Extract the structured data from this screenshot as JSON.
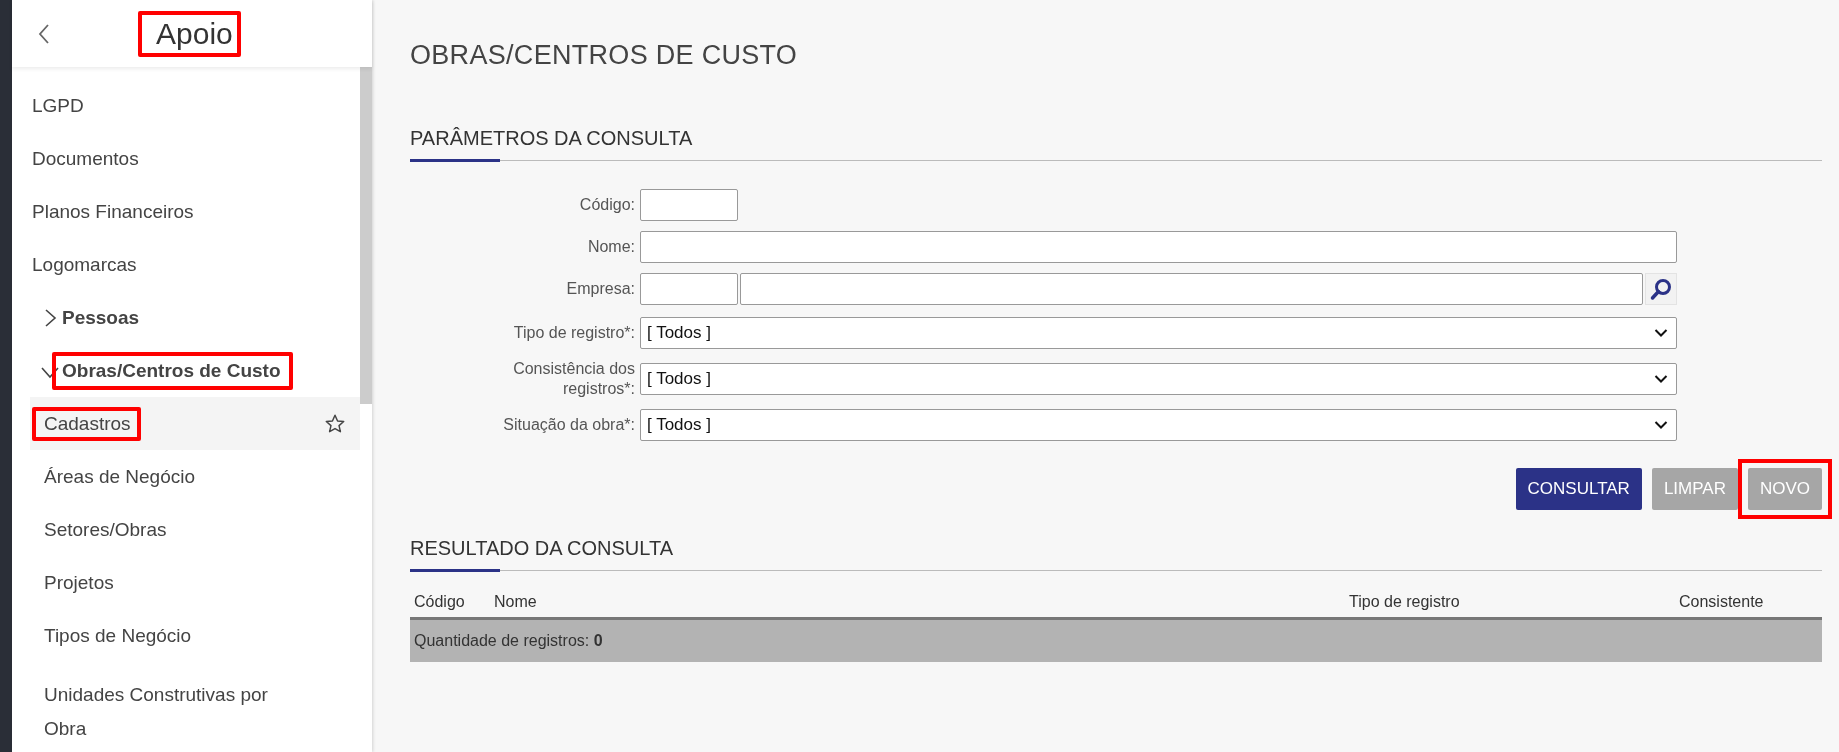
{
  "sidebar": {
    "title": "Apoio",
    "title_highlighted": true,
    "items": [
      {
        "kind": "link",
        "label": "LGPD",
        "selected": false,
        "highlighted": false
      },
      {
        "kind": "link",
        "label": "Documentos",
        "selected": false,
        "highlighted": false
      },
      {
        "kind": "link",
        "label": "Planos Financeiros",
        "selected": false,
        "highlighted": false
      },
      {
        "kind": "link",
        "label": "Logomarcas",
        "selected": false,
        "highlighted": false
      },
      {
        "kind": "group",
        "label": "Pessoas",
        "expanded": false,
        "highlighted": false
      },
      {
        "kind": "group",
        "label": "Obras/Centros de Custo",
        "expanded": true,
        "highlighted": true,
        "children": [
          {
            "kind": "link",
            "label": "Cadastros",
            "selected": true,
            "highlighted": true
          },
          {
            "kind": "link",
            "label": "Áreas de Negócio",
            "selected": false,
            "highlighted": false
          },
          {
            "kind": "link",
            "label": "Setores/Obras",
            "selected": false,
            "highlighted": false
          },
          {
            "kind": "link",
            "label": "Projetos",
            "selected": false,
            "highlighted": false
          },
          {
            "kind": "link",
            "label": "Tipos de Negócio",
            "selected": false,
            "highlighted": false
          },
          {
            "kind": "link",
            "label": "Unidades Construtivas por Obra",
            "selected": false,
            "highlighted": false
          }
        ]
      }
    ]
  },
  "page": {
    "title": "OBRAS/CENTROS DE CUSTO"
  },
  "parameters": {
    "heading": "PARÂMETROS DA CONSULTA",
    "fields": [
      {
        "kind": "code",
        "label": "Código:"
      },
      {
        "kind": "text",
        "label": "Nome:"
      },
      {
        "kind": "lookup",
        "label": "Empresa:"
      },
      {
        "kind": "select",
        "label": "Tipo de registro*:",
        "value": "[ Todos ]"
      },
      {
        "kind": "select",
        "label": "Consistência dos registros*:",
        "value": "[ Todos ]"
      },
      {
        "kind": "select",
        "label": "Situação da obra*:",
        "value": "[ Todos ]"
      }
    ],
    "buttons": [
      {
        "kind": "primary",
        "label": "CONSULTAR",
        "highlighted": false
      },
      {
        "kind": "secondary",
        "label": "LIMPAR",
        "highlighted": false
      },
      {
        "kind": "secondary",
        "label": "NOVO",
        "highlighted": true
      }
    ]
  },
  "results": {
    "heading": "RESULTADO DA CONSULTA",
    "columns": [
      "Código",
      "Nome",
      "Tipo de registro",
      "Consistente"
    ],
    "footer": "Quantidade de registros: **0**"
  }
}
